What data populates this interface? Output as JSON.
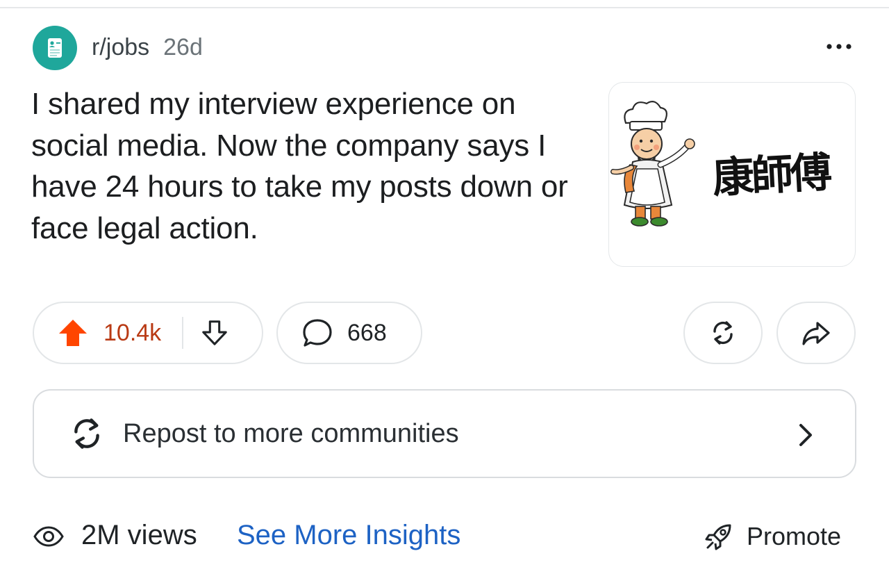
{
  "post": {
    "subreddit": "r/jobs",
    "age": "26d",
    "title": "I shared my interview experience on social media. Now the company says I have 24 hours to take my posts down or face legal action.",
    "thumbnail": {
      "logo_text": "康師傅"
    }
  },
  "actions": {
    "score": "10.4k",
    "vote_state": "upvoted",
    "comments": "668"
  },
  "repost": {
    "label": "Repost to more communities"
  },
  "footer": {
    "views": "2M views",
    "insights_link": "See More Insights",
    "promote": "Promote"
  },
  "colors": {
    "upvote": "#ff4500",
    "score_text": "#b93a14",
    "link": "#1d62c4",
    "avatar_bg": "#1fa79b"
  }
}
